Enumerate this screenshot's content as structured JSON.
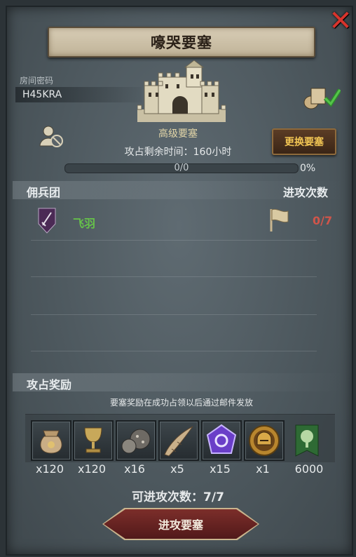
{
  "window": {
    "title": "嚎哭要塞",
    "close_icon": "close-icon"
  },
  "room": {
    "label": "房间密码",
    "code": "H45KRA"
  },
  "fortress": {
    "name": "高级要塞",
    "time_label": "攻占剩余时间：160小时",
    "change_button": "更换要塞",
    "progress_text": "0/0",
    "progress_percent": "0%",
    "progress_value": 0
  },
  "mercenary": {
    "section_title": "佣兵团",
    "attack_title": "进攻次数",
    "rows": [
      {
        "name": "飞羽",
        "attacks": "0/7"
      }
    ]
  },
  "rewards": {
    "section_title": "攻占奖励",
    "note": "要塞奖励在成功占领以后通过邮件发放",
    "items": [
      {
        "icon": "coin-sack-icon",
        "count": "x120"
      },
      {
        "icon": "goblet-icon",
        "count": "x120"
      },
      {
        "icon": "ore-icon",
        "count": "x16"
      },
      {
        "icon": "horn-icon",
        "count": "x5"
      },
      {
        "icon": "purple-gem-icon",
        "count": "x15"
      },
      {
        "icon": "golden-helmet-medal-icon",
        "count": "x1"
      },
      {
        "icon": "tree-banner-icon",
        "count": "6000"
      }
    ]
  },
  "footer": {
    "remaining_attacks": "可进攻次数：7/7",
    "attack_button": "进攻要塞"
  },
  "colors": {
    "merc_name": "#66c24a",
    "attack_count": "#d0554a",
    "change_button_text": "#f0c453",
    "close": "#d8342c"
  }
}
